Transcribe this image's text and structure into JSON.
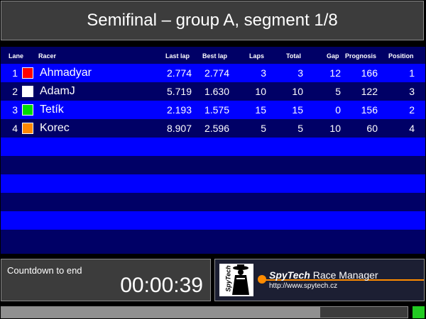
{
  "title": "Semifinal – group A, segment 1/8",
  "table": {
    "headers": {
      "lane": "Lane",
      "racer": "Racer",
      "last_lap": "Last lap",
      "best_lap": "Best lap",
      "laps": "Laps",
      "total": "Total",
      "gap": "Gap",
      "prognosis": "Prognosis",
      "position": "Position"
    },
    "rows": [
      {
        "lane": "1",
        "color": "#ff0000",
        "racer": "Ahmadyar",
        "last_lap": "2.774",
        "best_lap": "2.774",
        "laps": "3",
        "total": "3",
        "gap": "12",
        "prognosis": "166",
        "position": "1"
      },
      {
        "lane": "2",
        "color": "#ffffff",
        "racer": "AdamJ",
        "last_lap": "5.719",
        "best_lap": "1.630",
        "laps": "10",
        "total": "10",
        "gap": "5",
        "prognosis": "122",
        "position": "3"
      },
      {
        "lane": "3",
        "color": "#00dd00",
        "racer": "Tetík",
        "last_lap": "2.193",
        "best_lap": "1.575",
        "laps": "15",
        "total": "15",
        "gap": "0",
        "prognosis": "156",
        "position": "2"
      },
      {
        "lane": "4",
        "color": "#ff8800",
        "racer": "Korec",
        "last_lap": "8.907",
        "best_lap": "2.596",
        "laps": "5",
        "total": "5",
        "gap": "10",
        "prognosis": "60",
        "position": "4"
      }
    ]
  },
  "countdown": {
    "label": "Countdown to end",
    "time": "00:00:39"
  },
  "logo": {
    "emblem_text": "SpyTech",
    "brand_bold": "SpyTech",
    "brand_rest": " Race Manager",
    "url": "http://www.spytech.cz"
  },
  "progress": {
    "fraction": 0.785
  },
  "colors": {
    "row_light": "#0000ff",
    "row_dark": "#000066",
    "panel": "#3c3c3c",
    "accent": "#ff8c00",
    "status_light": "#22cc22"
  }
}
